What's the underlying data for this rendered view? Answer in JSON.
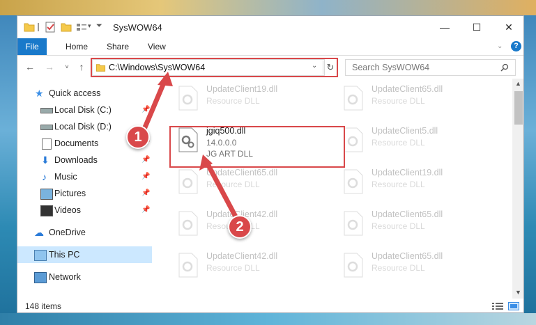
{
  "window": {
    "title": "SysWOW64",
    "controls": {
      "minimize": "—",
      "maximize": "☐",
      "close": "✕"
    }
  },
  "ribbon": {
    "tabs": [
      "File",
      "Home",
      "Share",
      "View"
    ]
  },
  "address": {
    "path": "C:\\Windows\\SysWOW64",
    "search_placeholder": "Search SysWOW64"
  },
  "nav": {
    "items": [
      {
        "label": "Quick access",
        "icon": "star-icon",
        "pinned": false
      },
      {
        "label": "Local Disk (C:)",
        "icon": "drive-icon",
        "pinned": true
      },
      {
        "label": "Local Disk (D:)",
        "icon": "drive-icon",
        "pinned": false
      },
      {
        "label": "Documents",
        "icon": "documents-icon",
        "pinned": true
      },
      {
        "label": "Downloads",
        "icon": "download-icon",
        "pinned": true
      },
      {
        "label": "Music",
        "icon": "music-icon",
        "pinned": true
      },
      {
        "label": "Pictures",
        "icon": "pictures-icon",
        "pinned": true
      },
      {
        "label": "Videos",
        "icon": "videos-icon",
        "pinned": true
      },
      {
        "label": "OneDrive",
        "icon": "cloud-icon",
        "pinned": false
      },
      {
        "label": "This PC",
        "icon": "computer-icon",
        "pinned": false
      },
      {
        "label": "Network",
        "icon": "network-icon",
        "pinned": false
      }
    ],
    "selected": "This PC"
  },
  "files": {
    "left": [
      {
        "name": "UpdateClient19.dll",
        "line2": "Resource DLL",
        "line3": ""
      },
      {
        "name": "jgiq500.dll",
        "line2": "14.0.0.0",
        "line3": "JG ART DLL"
      },
      {
        "name": "UpdateClient65.dll",
        "line2": "Resource DLL",
        "line3": ""
      },
      {
        "name": "UpdateClient42.dll",
        "line2": "Resource DLL",
        "line3": ""
      },
      {
        "name": "UpdateClient42.dll",
        "line2": "Resource DLL",
        "line3": ""
      }
    ],
    "right": [
      {
        "name": "UpdateClient65.dll",
        "line2": "Resource DLL"
      },
      {
        "name": "UpdateClient5.dll",
        "line2": "Resource DLL"
      },
      {
        "name": "UpdateClient19.dll",
        "line2": "Resource DLL"
      },
      {
        "name": "UpdateClient65.dll",
        "line2": "Resource DLL"
      },
      {
        "name": "UpdateClient65.dll",
        "line2": "Resource DLL"
      }
    ]
  },
  "status": {
    "count": "148 items"
  },
  "callouts": {
    "one": "1",
    "two": "2"
  },
  "colors": {
    "accent": "#1979ca",
    "highlight": "#d9484a",
    "selection": "#cce8ff"
  }
}
